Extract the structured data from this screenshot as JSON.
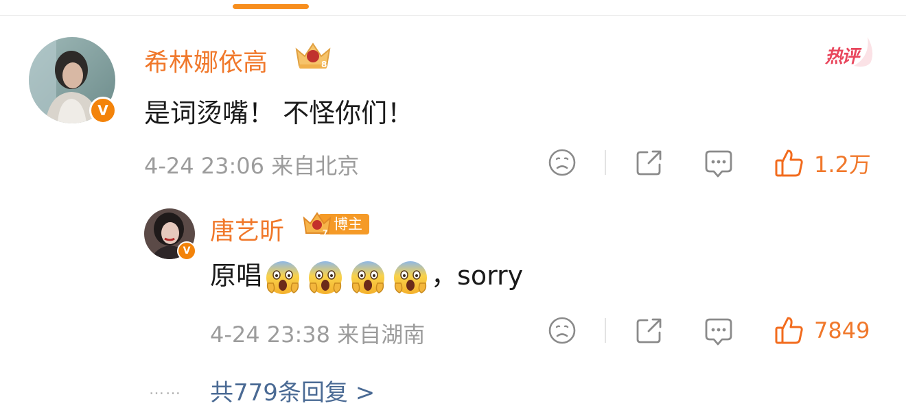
{
  "hot_label": "热评",
  "main_comment": {
    "username": "希林娜依高",
    "text": "是词烫嘴！ 不怪你们！",
    "meta": "4-24 23:06 来自北京",
    "likes": "1.2万",
    "verified_badge": "V",
    "crown_badge": "8"
  },
  "reply": {
    "username": "唐艺昕",
    "blogger_tag": "博主",
    "text_before": "原唱",
    "emoji_count": 4,
    "text_after": "，sorry",
    "meta": "4-24 23:38 来自湖南",
    "likes": "7849",
    "verified_badge": "V",
    "crown_badge": "7"
  },
  "replies_link": "共779条回复 >",
  "dots": "……",
  "colors": {
    "accent": "#f0782b",
    "like_icon": "#f26b1d",
    "hot": "#e9475d",
    "link": "#4a6a94",
    "meta": "#9c9c9c",
    "tab_indicator": "#f78e1e"
  },
  "icons": [
    "face-icon",
    "share-icon",
    "comment-icon",
    "thumbs-up-icon",
    "crown-icon",
    "verified-v-icon",
    "scream-emoji-icon"
  ]
}
